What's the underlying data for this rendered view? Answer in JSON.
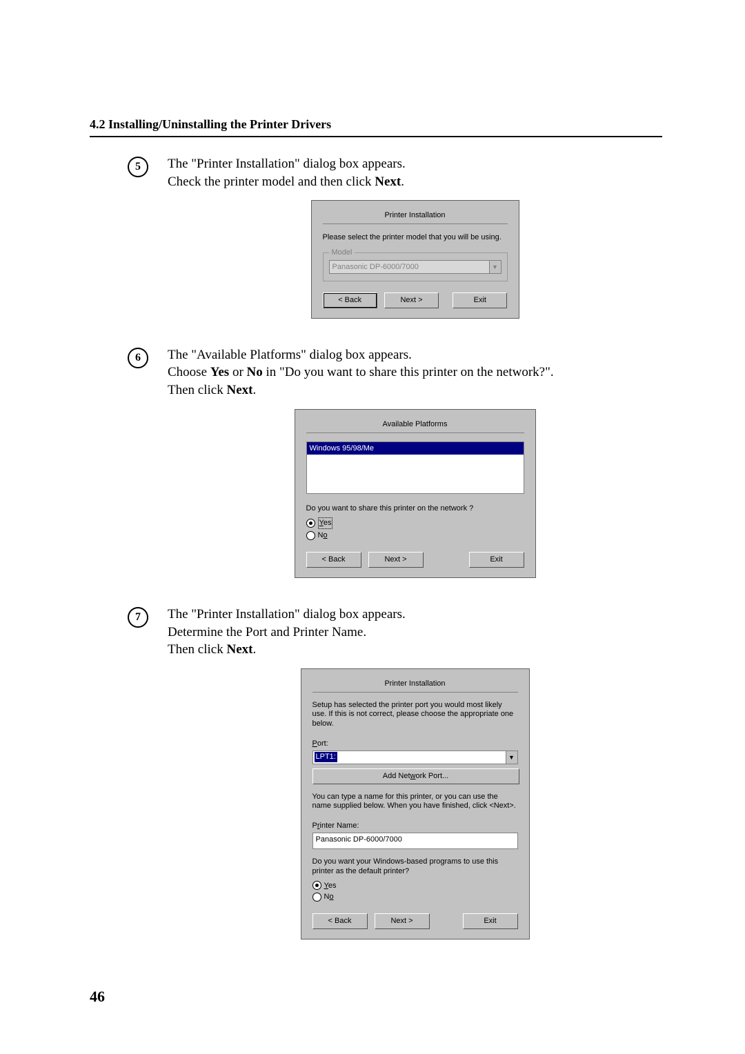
{
  "section_title": "4.2 Installing/Uninstalling the Printer Drivers",
  "page_number": "46",
  "steps": {
    "s5": {
      "num": "5",
      "line1a": "The \"Printer Installation\" dialog box appears.",
      "line2a": "Check the printer model and then click ",
      "line2b": "Next",
      "line2c": "."
    },
    "s6": {
      "num": "6",
      "line1": "The \"Available Platforms\" dialog box appears.",
      "line2a": "Choose ",
      "line2yes": "Yes",
      "line2b": " or ",
      "line2no": "No",
      "line2c": " in \"Do you want to share this printer on the network?\".",
      "line3a": "Then click ",
      "line3b": "Next",
      "line3c": "."
    },
    "s7": {
      "num": "7",
      "line1": "The \"Printer Installation\" dialog box appears.",
      "line2": "Determine the Port and Printer Name.",
      "line3a": "Then click ",
      "line3b": "Next",
      "line3c": "."
    }
  },
  "dialog1": {
    "title": "Printer Installation",
    "prompt": "Please select the printer model that you will be using.",
    "group_label": "Model",
    "combo_value": "Panasonic DP-6000/7000",
    "btn_back": "< Back",
    "btn_next": "Next >",
    "btn_exit": "Exit"
  },
  "dialog2": {
    "title": "Available Platforms",
    "list_item": "Windows 95/98/Me",
    "question": "Do you want to share this printer on the network ?",
    "yes_u": "Y",
    "yes_rest": "es",
    "no_u": "o",
    "no_first": "N",
    "btn_back": "< Back",
    "btn_next": "Next >",
    "btn_exit": "Exit"
  },
  "dialog3": {
    "title": "Printer Installation",
    "para1": "Setup has selected the printer port you would most likely use. If this is not correct, please choose the appropriate one below.",
    "port_u": "P",
    "port_rest": "ort:",
    "port_value": "LPT1:",
    "add_port_pre": "Add Net",
    "add_port_u": "w",
    "add_port_post": "ork Port...",
    "para2": "You can type a name for this printer, or you can use the name supplied below. When you have finished, click <Next>.",
    "pname_pre": "P",
    "pname_u": "r",
    "pname_post": "inter Name:",
    "printer_name": "Panasonic DP-6000/7000",
    "para3": "Do you want your Windows-based programs to use this printer as the default printer?",
    "yes_u": "Y",
    "yes_rest": "es",
    "no_first": "N",
    "no_u": "o",
    "btn_back": "< Back",
    "btn_next": "Next >",
    "btn_exit": "Exit"
  }
}
